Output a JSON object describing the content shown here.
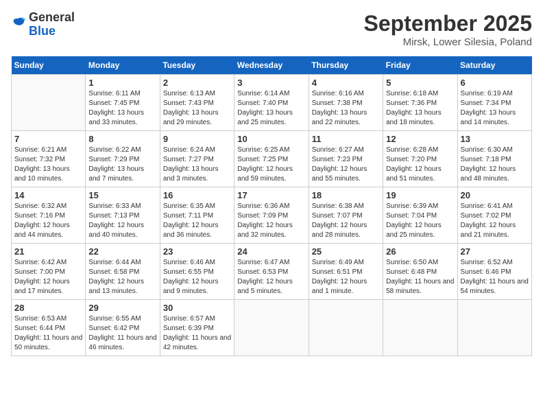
{
  "header": {
    "logo_general": "General",
    "logo_blue": "Blue",
    "title": "September 2025",
    "subtitle": "Mirsk, Lower Silesia, Poland"
  },
  "calendar": {
    "days_of_week": [
      "Sunday",
      "Monday",
      "Tuesday",
      "Wednesday",
      "Thursday",
      "Friday",
      "Saturday"
    ],
    "weeks": [
      [
        {
          "day": "",
          "sunrise": "",
          "sunset": "",
          "daylight": ""
        },
        {
          "day": "1",
          "sunrise": "6:11 AM",
          "sunset": "7:45 PM",
          "daylight": "13 hours and 33 minutes."
        },
        {
          "day": "2",
          "sunrise": "6:13 AM",
          "sunset": "7:43 PM",
          "daylight": "13 hours and 29 minutes."
        },
        {
          "day": "3",
          "sunrise": "6:14 AM",
          "sunset": "7:40 PM",
          "daylight": "13 hours and 25 minutes."
        },
        {
          "day": "4",
          "sunrise": "6:16 AM",
          "sunset": "7:38 PM",
          "daylight": "13 hours and 22 minutes."
        },
        {
          "day": "5",
          "sunrise": "6:18 AM",
          "sunset": "7:36 PM",
          "daylight": "13 hours and 18 minutes."
        },
        {
          "day": "6",
          "sunrise": "6:19 AM",
          "sunset": "7:34 PM",
          "daylight": "13 hours and 14 minutes."
        }
      ],
      [
        {
          "day": "7",
          "sunrise": "6:21 AM",
          "sunset": "7:32 PM",
          "daylight": "13 hours and 10 minutes."
        },
        {
          "day": "8",
          "sunrise": "6:22 AM",
          "sunset": "7:29 PM",
          "daylight": "13 hours and 7 minutes."
        },
        {
          "day": "9",
          "sunrise": "6:24 AM",
          "sunset": "7:27 PM",
          "daylight": "13 hours and 3 minutes."
        },
        {
          "day": "10",
          "sunrise": "6:25 AM",
          "sunset": "7:25 PM",
          "daylight": "12 hours and 59 minutes."
        },
        {
          "day": "11",
          "sunrise": "6:27 AM",
          "sunset": "7:23 PM",
          "daylight": "12 hours and 55 minutes."
        },
        {
          "day": "12",
          "sunrise": "6:28 AM",
          "sunset": "7:20 PM",
          "daylight": "12 hours and 51 minutes."
        },
        {
          "day": "13",
          "sunrise": "6:30 AM",
          "sunset": "7:18 PM",
          "daylight": "12 hours and 48 minutes."
        }
      ],
      [
        {
          "day": "14",
          "sunrise": "6:32 AM",
          "sunset": "7:16 PM",
          "daylight": "12 hours and 44 minutes."
        },
        {
          "day": "15",
          "sunrise": "6:33 AM",
          "sunset": "7:13 PM",
          "daylight": "12 hours and 40 minutes."
        },
        {
          "day": "16",
          "sunrise": "6:35 AM",
          "sunset": "7:11 PM",
          "daylight": "12 hours and 36 minutes."
        },
        {
          "day": "17",
          "sunrise": "6:36 AM",
          "sunset": "7:09 PM",
          "daylight": "12 hours and 32 minutes."
        },
        {
          "day": "18",
          "sunrise": "6:38 AM",
          "sunset": "7:07 PM",
          "daylight": "12 hours and 28 minutes."
        },
        {
          "day": "19",
          "sunrise": "6:39 AM",
          "sunset": "7:04 PM",
          "daylight": "12 hours and 25 minutes."
        },
        {
          "day": "20",
          "sunrise": "6:41 AM",
          "sunset": "7:02 PM",
          "daylight": "12 hours and 21 minutes."
        }
      ],
      [
        {
          "day": "21",
          "sunrise": "6:42 AM",
          "sunset": "7:00 PM",
          "daylight": "12 hours and 17 minutes."
        },
        {
          "day": "22",
          "sunrise": "6:44 AM",
          "sunset": "6:58 PM",
          "daylight": "12 hours and 13 minutes."
        },
        {
          "day": "23",
          "sunrise": "6:46 AM",
          "sunset": "6:55 PM",
          "daylight": "12 hours and 9 minutes."
        },
        {
          "day": "24",
          "sunrise": "6:47 AM",
          "sunset": "6:53 PM",
          "daylight": "12 hours and 5 minutes."
        },
        {
          "day": "25",
          "sunrise": "6:49 AM",
          "sunset": "6:51 PM",
          "daylight": "12 hours and 1 minute."
        },
        {
          "day": "26",
          "sunrise": "6:50 AM",
          "sunset": "6:48 PM",
          "daylight": "11 hours and 58 minutes."
        },
        {
          "day": "27",
          "sunrise": "6:52 AM",
          "sunset": "6:46 PM",
          "daylight": "11 hours and 54 minutes."
        }
      ],
      [
        {
          "day": "28",
          "sunrise": "6:53 AM",
          "sunset": "6:44 PM",
          "daylight": "11 hours and 50 minutes."
        },
        {
          "day": "29",
          "sunrise": "6:55 AM",
          "sunset": "6:42 PM",
          "daylight": "11 hours and 46 minutes."
        },
        {
          "day": "30",
          "sunrise": "6:57 AM",
          "sunset": "6:39 PM",
          "daylight": "11 hours and 42 minutes."
        },
        {
          "day": "",
          "sunrise": "",
          "sunset": "",
          "daylight": ""
        },
        {
          "day": "",
          "sunrise": "",
          "sunset": "",
          "daylight": ""
        },
        {
          "day": "",
          "sunrise": "",
          "sunset": "",
          "daylight": ""
        },
        {
          "day": "",
          "sunrise": "",
          "sunset": "",
          "daylight": ""
        }
      ]
    ]
  }
}
